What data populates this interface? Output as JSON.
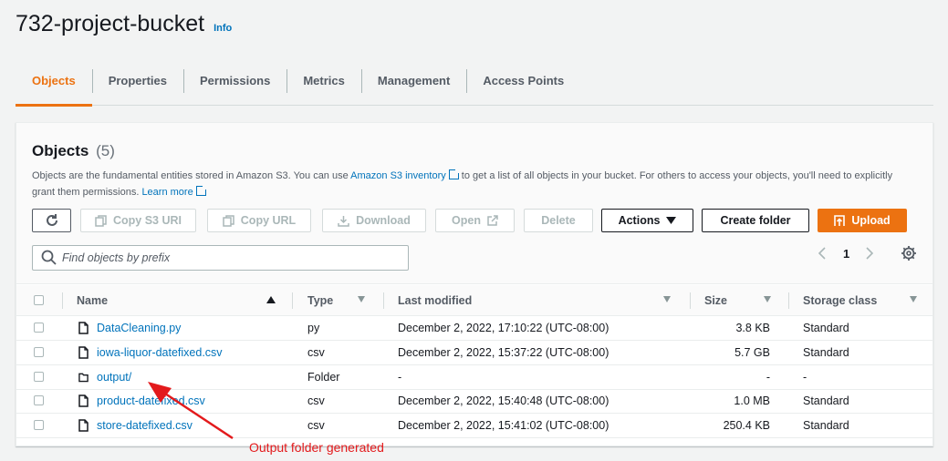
{
  "header": {
    "title": "732-project-bucket",
    "info": "Info"
  },
  "tabs": [
    "Objects",
    "Properties",
    "Permissions",
    "Metrics",
    "Management",
    "Access Points"
  ],
  "objects_panel": {
    "heading": "Objects",
    "count": "(5)",
    "desc_part1": "Objects are the fundamental entities stored in Amazon S3. You can use ",
    "inventory_link": "Amazon S3 inventory",
    "desc_part2": " to get a list of all objects in your bucket. For others to access your objects, you'll need to explicitly grant them permissions. ",
    "learn_more": "Learn more"
  },
  "toolbar": {
    "refresh_icon": "refresh-icon",
    "copy_s3_uri": "Copy S3 URI",
    "copy_url": "Copy URL",
    "download": "Download",
    "open": "Open",
    "delete": "Delete",
    "actions": "Actions",
    "create_folder": "Create folder",
    "upload": "Upload"
  },
  "search": {
    "placeholder": "Find objects by prefix"
  },
  "pagination": {
    "page": "1"
  },
  "table": {
    "columns": [
      "Name",
      "Type",
      "Last modified",
      "Size",
      "Storage class"
    ],
    "rows": [
      {
        "name": "DataCleaning.py",
        "type": "py",
        "modified": "December 2, 2022, 17:10:22 (UTC-08:00)",
        "size": "3.8 KB",
        "class": "Standard",
        "icon": "file-icon"
      },
      {
        "name": "iowa-liquor-datefixed.csv",
        "type": "csv",
        "modified": "December 2, 2022, 15:37:22 (UTC-08:00)",
        "size": "5.7 GB",
        "class": "Standard",
        "icon": "file-icon"
      },
      {
        "name": "output/",
        "type": "Folder",
        "modified": "-",
        "size": "-",
        "class": "-",
        "icon": "folder-icon"
      },
      {
        "name": "product-datefixed.csv",
        "type": "csv",
        "modified": "December 2, 2022, 15:40:48 (UTC-08:00)",
        "size": "1.0 MB",
        "class": "Standard",
        "icon": "file-icon"
      },
      {
        "name": "store-datefixed.csv",
        "type": "csv",
        "modified": "December 2, 2022, 15:41:02 (UTC-08:00)",
        "size": "250.4 KB",
        "class": "Standard",
        "icon": "file-icon"
      }
    ]
  },
  "annotation": {
    "text": "Output folder generated",
    "color": "#e31a1c"
  },
  "colors": {
    "accent": "#ec7211",
    "link": "#0073bb"
  }
}
